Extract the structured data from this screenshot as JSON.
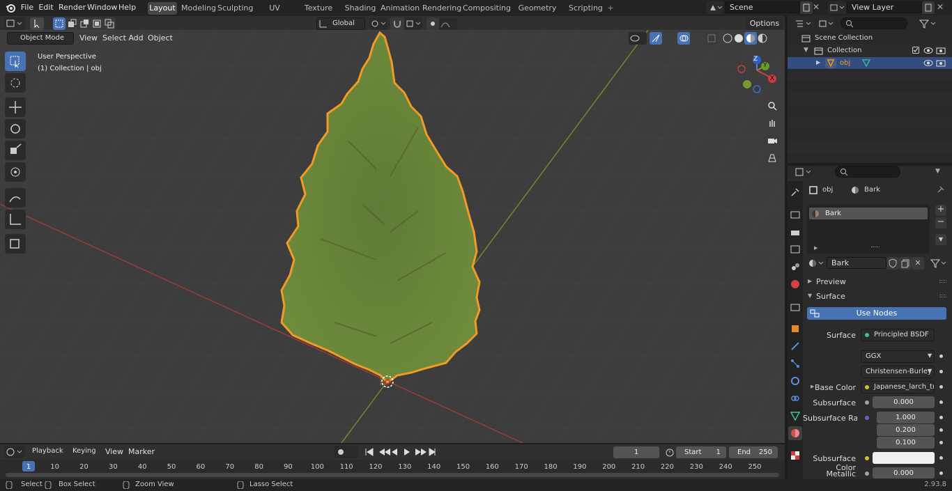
{
  "menu": {
    "file": "File",
    "edit": "Edit",
    "render": "Render",
    "window": "Window",
    "help": "Help"
  },
  "workspaces": [
    "Layout",
    "Modeling",
    "Sculpting",
    "UV Editing",
    "Texture Paint",
    "Shading",
    "Animation",
    "Rendering",
    "Compositing",
    "Geometry Nodes",
    "Scripting"
  ],
  "active_workspace": "Layout",
  "scene": "Scene",
  "view_layer": "View Layer",
  "viewport": {
    "mode": "Object Mode",
    "menu": [
      "View",
      "Select",
      "Add",
      "Object"
    ],
    "orientation": "Global",
    "options_label": "Options",
    "overlay_title": "User Perspective",
    "overlay_sub": "(1) Collection | obj",
    "gizmo": {
      "z": "Z",
      "y": "Y",
      "x": "X"
    }
  },
  "outliner": {
    "scene_collection": "Scene Collection",
    "collection": "Collection",
    "object": "obj"
  },
  "properties": {
    "breadcrumb_object": "obj",
    "breadcrumb_material": "Bark",
    "slot": "Bark",
    "material_name": "Bark",
    "preview": "Preview",
    "surface_panel": "Surface",
    "use_nodes": "Use Nodes",
    "surface_label": "Surface",
    "surface_value": "Principled BSDF",
    "distribution": "GGX",
    "subsurface_method": "Christensen-Burley",
    "base_color_label": "Base Color",
    "base_color_value": "Japanese_larch_tree...",
    "subsurface_label": "Subsurface",
    "subsurface_value": "0.000",
    "subsurface_radius_label": "Subsurface Radi...",
    "radius": [
      "1.000",
      "0.200",
      "0.100"
    ],
    "subsurface_color_label": "Subsurface Color",
    "metallic_label": "Metallic",
    "metallic_value": "0.000"
  },
  "timeline": {
    "menu": [
      "Playback",
      "Keying",
      "View",
      "Marker"
    ],
    "current_frame": "1",
    "start_label": "Start",
    "start": "1",
    "end_label": "End",
    "end": "250",
    "ticks": [
      "1",
      "10",
      "20",
      "30",
      "40",
      "50",
      "60",
      "70",
      "80",
      "90",
      "100",
      "110",
      "120",
      "130",
      "140",
      "150",
      "160",
      "170",
      "180",
      "190",
      "200",
      "210",
      "220",
      "230",
      "240",
      "250"
    ]
  },
  "status": {
    "select": "Select",
    "box_select": "Box Select",
    "zoom_view": "Zoom View",
    "lasso_select": "Lasso Select",
    "version": "2.93.8"
  },
  "colors": {
    "accent": "#4772b3",
    "selection_orange": "#f29a26",
    "tree_green": "#6f8a3c"
  }
}
